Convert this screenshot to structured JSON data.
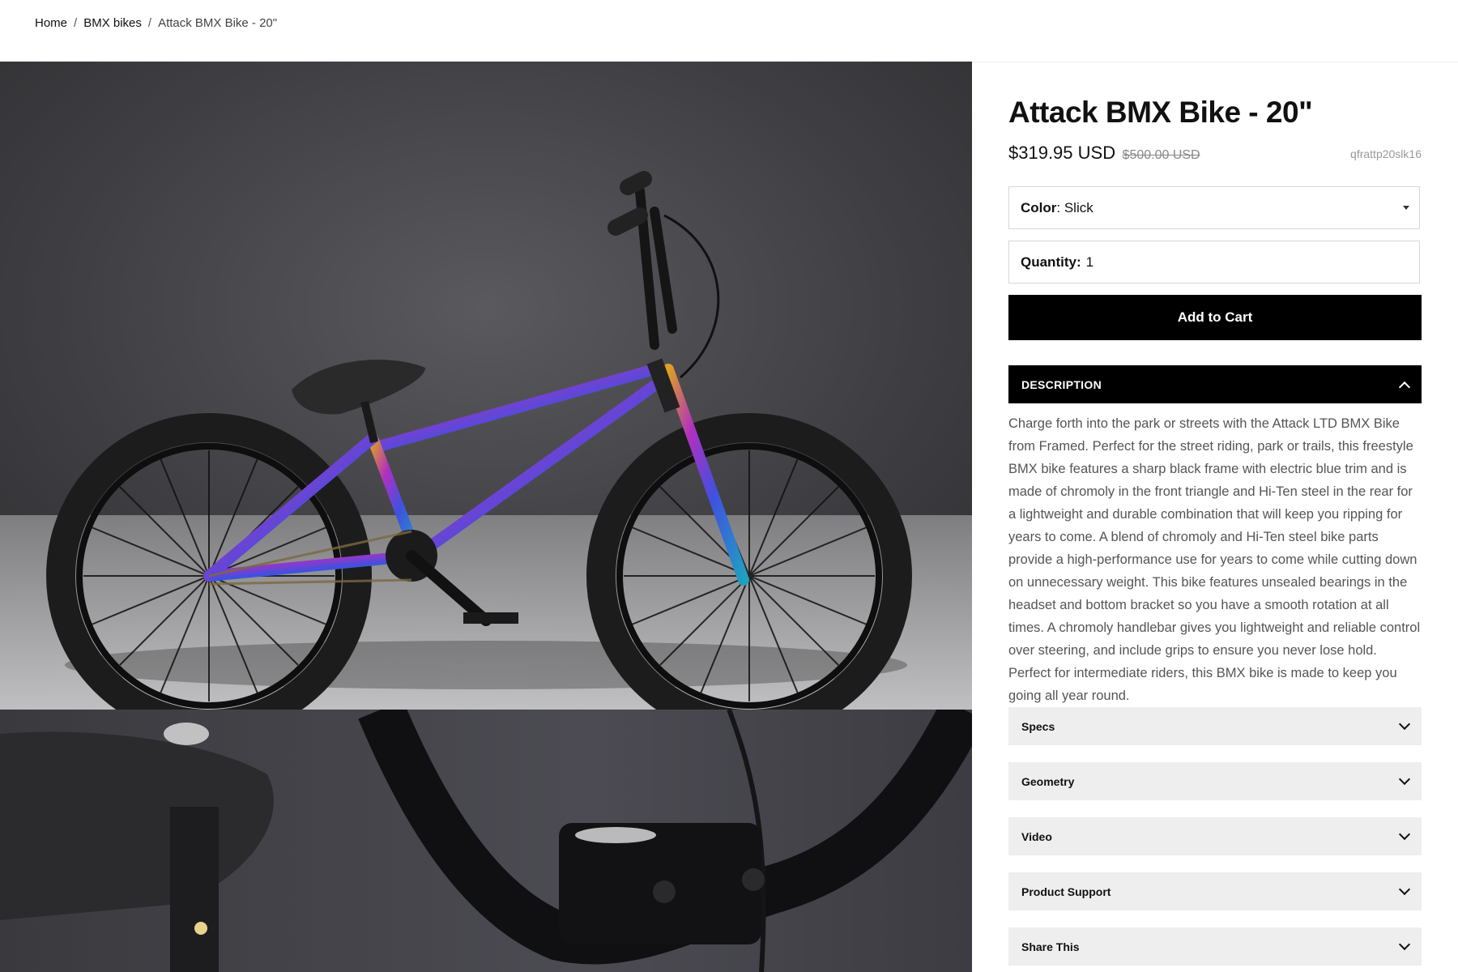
{
  "breadcrumb": {
    "items": [
      "Home",
      "BMX bikes"
    ],
    "separator": "/",
    "current": "Attack BMX Bike - 20\""
  },
  "product": {
    "title": "Attack BMX Bike - 20\"",
    "price": "$319.95 USD",
    "compare_price": "$500.00 USD",
    "sku": "qfrattp20slk16",
    "color_label": "Color",
    "color_value": "Slick",
    "quantity_label": "Quantity:",
    "quantity_value": "1",
    "add_to_cart": "Add to Cart"
  },
  "accordion": {
    "description_title": "DESCRIPTION",
    "description_text": "Charge forth into the park or streets with the Attack LTD BMX Bike from Framed. Perfect for the street riding, park or trails, this freestyle BMX bike features a sharp black frame with electric blue trim and is made of chromoly in the front triangle and Hi-Ten steel in the rear for a lightweight and durable combination that will keep you ripping for years to come. A blend of chromoly and Hi-Ten steel bike parts provide a high-performance use for years to come while cutting down on unnecessary weight. This bike features unsealed bearings in the headset and bottom bracket so you have a smooth rotation at all times. A chromoly handlebar gives you lightweight and reliable control over steering, and include grips to ensure you never lose hold. Perfect for intermediate riders, this BMX bike is made to keep you going all year round.",
    "sections": [
      "Specs",
      "Geometry",
      "Video",
      "Product Support",
      "Share This"
    ]
  },
  "icons": {
    "dropdown": "caret-down-icon",
    "collapse": "chevron-up-icon",
    "expand": "chevron-down-icon"
  },
  "colors": {
    "button_bg": "#000000",
    "accordion_closed_bg": "#eeeeee",
    "photo_bg": "#4a4a4d"
  }
}
